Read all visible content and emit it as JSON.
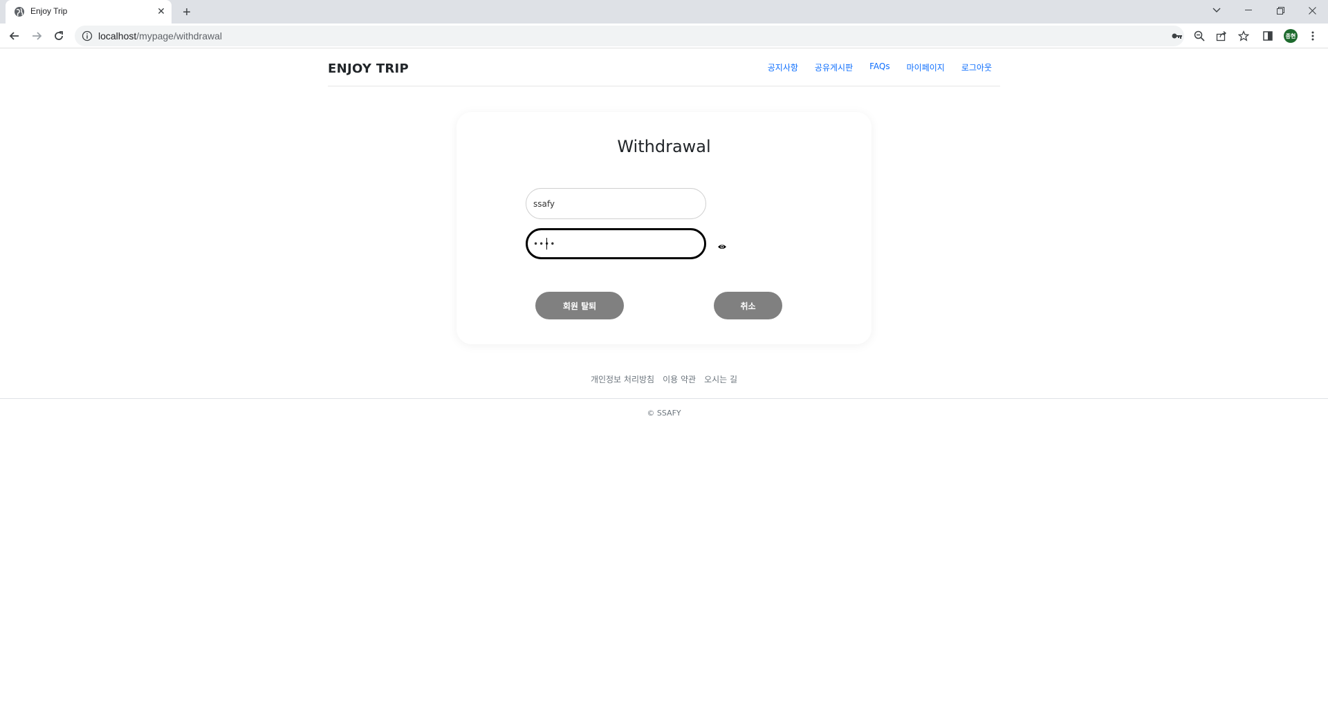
{
  "browser": {
    "tab_title": "Enjoy Trip",
    "url_host": "localhost",
    "url_path": "/mypage/withdrawal",
    "profile_initials": "종현"
  },
  "header": {
    "logo": "ENJOY TRIP",
    "nav": [
      "공지사항",
      "공유게시판",
      "FAQs",
      "마이페이지",
      "로그아웃"
    ]
  },
  "withdrawal": {
    "title": "Withdrawal",
    "id_value": "ssafy",
    "password_value": "••••",
    "withdraw_label": "회원 탈퇴",
    "cancel_label": "취소"
  },
  "footer": {
    "links": [
      "개인정보 처리방침",
      "이용 약관",
      "오시는 길"
    ],
    "copyright": "© SSAFY"
  },
  "colors": {
    "nav_link": "#0d6efd",
    "button_bg": "#808080",
    "tabbar_bg": "#dee1e6"
  }
}
